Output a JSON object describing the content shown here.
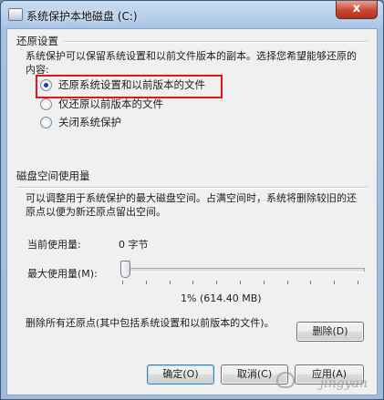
{
  "window": {
    "title": "系统保护本地磁盘 (C:)",
    "close_glyph": "x"
  },
  "restore": {
    "group_title": "还原设置",
    "description": "系统保护可以保留系统设置和以前文件版本的副本。选择您希望能够还原的内容:",
    "options": [
      {
        "label": "还原系统设置和以前版本的文件",
        "checked": true
      },
      {
        "label": "仅还原以前版本的文件",
        "checked": false
      },
      {
        "label": "关闭系统保护",
        "checked": false
      }
    ]
  },
  "disk": {
    "group_title": "磁盘空间使用量",
    "description": "可以调整用于系统保护的最大磁盘空间。占满空间时，系统将删除较旧的还原点以便为新还原点留出空间。",
    "current_usage_label": "当前使用量:",
    "current_usage_value": "0 字节",
    "max_usage_label": "最大使用量",
    "max_usage_accel": "(M):",
    "max_usage_fraction": 0.01,
    "max_usage_readout": "1% (614.40 MB)"
  },
  "delete": {
    "description": "删除所有还原点(其中包括系统设置和以前版本的文件)。",
    "button_label": "删除(D)"
  },
  "footer": {
    "ok_label": "确定(O)",
    "cancel_label": "取消(C)",
    "apply_label": "应用(A)"
  },
  "watermark": {
    "text": "jingyan"
  }
}
